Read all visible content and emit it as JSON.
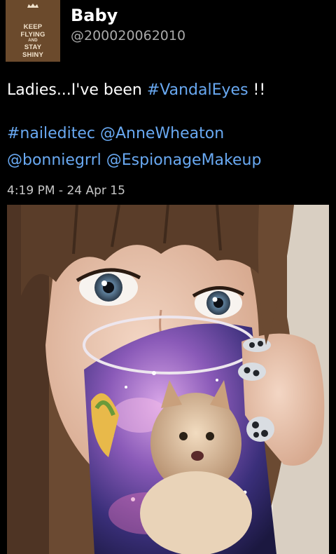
{
  "author": {
    "display_name": "Baby",
    "handle": "@200020062010",
    "avatar": {
      "icon": "keep-flying-poster-avatar",
      "lines": [
        "KEEP",
        "FLYING",
        "AND",
        "STAY",
        "SHINY"
      ],
      "background": "#6b4a2c",
      "text_color": "#f1e2cc"
    }
  },
  "tweet": {
    "line1_text": "Ladies...I've been ",
    "line1_tag": "#VandalEyes",
    "line1_suffix": " !!",
    "tag_naileditec": "#naileditec",
    "mention_annewheaton": "@AnneWheaton",
    "mention_bonniegrrl": "@bonniegrrl",
    "mention_espionagemakeup": "@EspionageMakeup",
    "timestamp": "4:19 PM - 24 Apr 15"
  },
  "media": {
    "icon": "photo-woman-drinking-from-space-cat-mug"
  },
  "colors": {
    "background": "#000000",
    "link": "#69a9f2",
    "handle": "#a9a9a9",
    "timestamp": "#c7c7c7"
  }
}
